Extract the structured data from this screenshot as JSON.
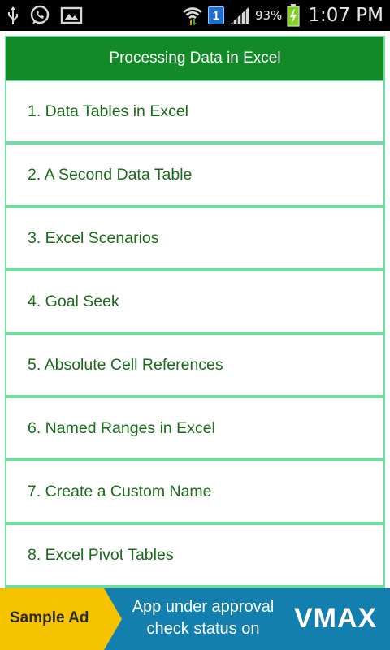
{
  "status_bar": {
    "battery_percent": "93%",
    "time": "1:07 PM",
    "notification_badge": "1"
  },
  "header": {
    "title": "Processing Data in Excel"
  },
  "menu": {
    "items": [
      "1. Data Tables in Excel",
      "2. A Second Data Table",
      "3. Excel Scenarios",
      "4. Goal Seek",
      "5. Absolute Cell References",
      "6. Named Ranges in Excel",
      "7. Create a Custom Name",
      "8. Excel Pivot Tables"
    ]
  },
  "ad": {
    "label": "Sample Ad",
    "line1": "App under approval",
    "line2": "check status on",
    "brand": "VMAX"
  },
  "colors": {
    "header_bg": "#138a28",
    "item_text": "#1a6b1a",
    "item_border": "#6fdca0",
    "ad_bg": "#127fae",
    "ad_accent": "#f5c300"
  }
}
